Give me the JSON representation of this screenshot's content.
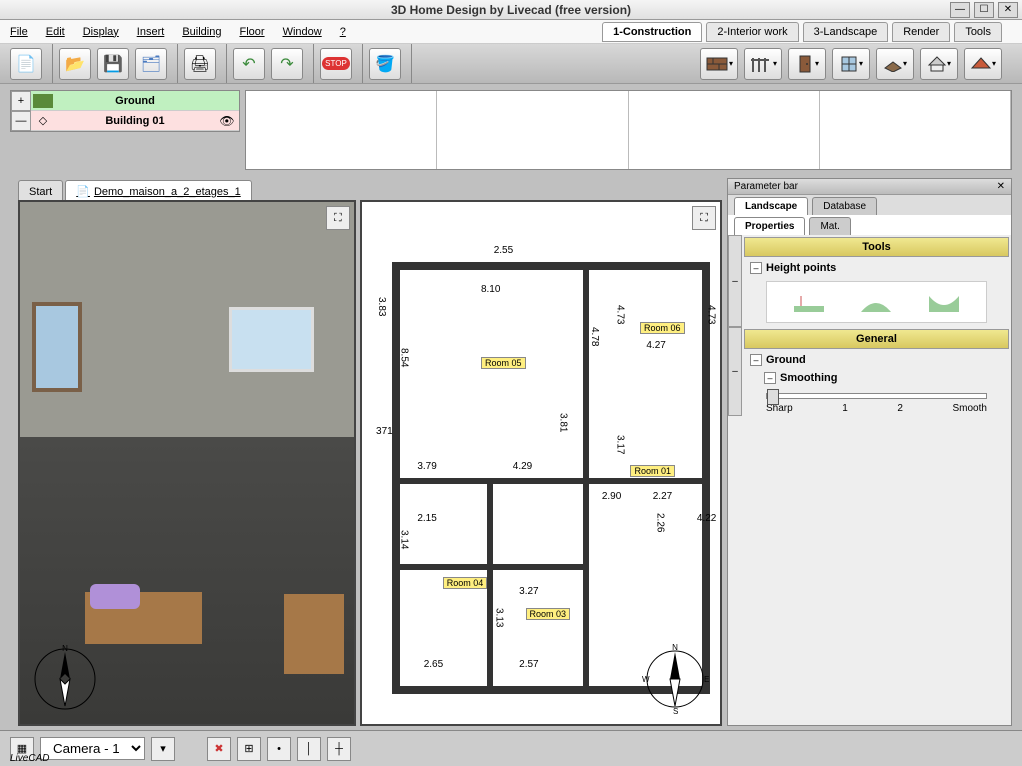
{
  "window": {
    "title": "3D Home Design by Livecad (free version)"
  },
  "menu": {
    "file": "File",
    "edit": "Edit",
    "display": "Display",
    "insert": "Insert",
    "building": "Building",
    "floor": "Floor",
    "window": "Window",
    "help": "?"
  },
  "modetabs": {
    "construction": "1-Construction",
    "interior": "2-Interior work",
    "landscape": "3-Landscape",
    "render": "Render",
    "tools": "Tools"
  },
  "layers": {
    "ground": "Ground",
    "building": "Building 01"
  },
  "doctabs": {
    "start": "Start",
    "demo": "Demo_maison_a_2_etages_1"
  },
  "parameter": {
    "title": "Parameter bar",
    "tab_landscape": "Landscape",
    "tab_database": "Database",
    "tab_properties": "Properties",
    "tab_mat": "Mat.",
    "section_tools": "Tools",
    "height_points": "Height points",
    "section_general": "General",
    "ground": "Ground",
    "smoothing": "Smoothing",
    "slider": {
      "sharp": "Sharp",
      "v1": "1",
      "v2": "2",
      "smooth": "Smooth"
    }
  },
  "floorplan": {
    "rooms": {
      "r01": "Room 01",
      "r03": "Room 03",
      "r04": "Room 04",
      "r05": "Room 05",
      "r06": "Room 06"
    },
    "dims": {
      "d255": "2.55",
      "d810": "8.10",
      "d478": "4.78",
      "d473a": "4.73",
      "d473b": "4.73",
      "d427": "4.27",
      "d854": "8.54",
      "d383": "3.83",
      "d371": "371",
      "d379": "3.79",
      "d381": "3.81",
      "d429": "4.29",
      "d290": "2.90",
      "d227": "2.27",
      "d226": "2.26",
      "d422": "4.22",
      "d317": "3.17",
      "d215": "2.15",
      "d314": "3.14",
      "d327": "3.27",
      "d265": "2.65",
      "d257": "2.57",
      "d313": "3.13"
    }
  },
  "status": {
    "camera": "Camera - 1"
  },
  "footer": {
    "brand": "LiveCAD"
  }
}
